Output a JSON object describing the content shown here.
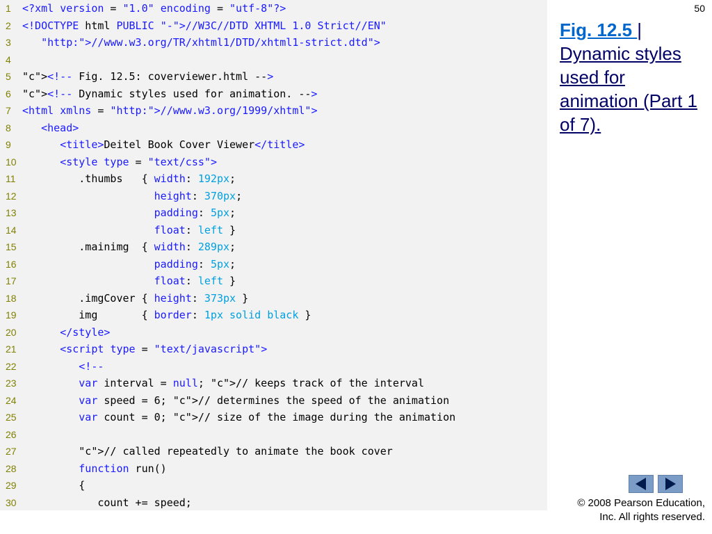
{
  "slide_number": "50",
  "caption": {
    "link": "Fig. 12.5 ",
    "separator": "|",
    "description": "Dynamic styles used for animation (Part 1 of 7)."
  },
  "copyright": {
    "line1": "© 2008 Pearson Education,",
    "line2": "Inc.  All rights reserved."
  },
  "nav": {
    "back_icon": "previous-arrow-icon",
    "forward_icon": "next-arrow-icon"
  },
  "code_lines": [
    {
      "n": "1",
      "text": "<?xml version = \"1.0\" encoding = \"utf-8\"?>"
    },
    {
      "n": "2",
      "text": "<!DOCTYPE html PUBLIC \"-//W3C//DTD XHTML 1.0 Strict//EN\""
    },
    {
      "n": "3",
      "text": "   \"http://www.w3.org/TR/xhtml1/DTD/xhtml1-strict.dtd\">"
    },
    {
      "n": "4",
      "text": ""
    },
    {
      "n": "5",
      "text": "<!-- Fig. 12.5: coverviewer.html -->"
    },
    {
      "n": "6",
      "text": "<!-- Dynamic styles used for animation. -->"
    },
    {
      "n": "7",
      "text": "<html xmlns = \"http://www.w3.org/1999/xhtml\">"
    },
    {
      "n": "8",
      "text": "   <head>"
    },
    {
      "n": "9",
      "text": "      <title>Deitel Book Cover Viewer</title>"
    },
    {
      "n": "10",
      "text": "      <style type = \"text/css\">"
    },
    {
      "n": "11",
      "text": "         .thumbs   { width: 192px;"
    },
    {
      "n": "12",
      "text": "                     height: 370px;"
    },
    {
      "n": "13",
      "text": "                     padding: 5px;"
    },
    {
      "n": "14",
      "text": "                     float: left }"
    },
    {
      "n": "15",
      "text": "         .mainimg  { width: 289px;"
    },
    {
      "n": "16",
      "text": "                     padding: 5px;"
    },
    {
      "n": "17",
      "text": "                     float: left }"
    },
    {
      "n": "18",
      "text": "         .imgCover { height: 373px }"
    },
    {
      "n": "19",
      "text": "         img       { border: 1px solid black }"
    },
    {
      "n": "20",
      "text": "      </style>"
    },
    {
      "n": "21",
      "text": "      <script type = \"text/javascript\">"
    },
    {
      "n": "22",
      "text": "         <!--"
    },
    {
      "n": "23",
      "text": "         var interval = null; // keeps track of the interval"
    },
    {
      "n": "24",
      "text": "         var speed = 6; // determines the speed of the animation"
    },
    {
      "n": "25",
      "text": "         var count = 0; // size of the image during the animation"
    },
    {
      "n": "26",
      "text": ""
    },
    {
      "n": "27",
      "text": "         // called repeatedly to animate the book cover"
    },
    {
      "n": "28",
      "text": "         function run()"
    },
    {
      "n": "29",
      "text": "         {"
    },
    {
      "n": "30",
      "text": "            count += speed;"
    }
  ]
}
